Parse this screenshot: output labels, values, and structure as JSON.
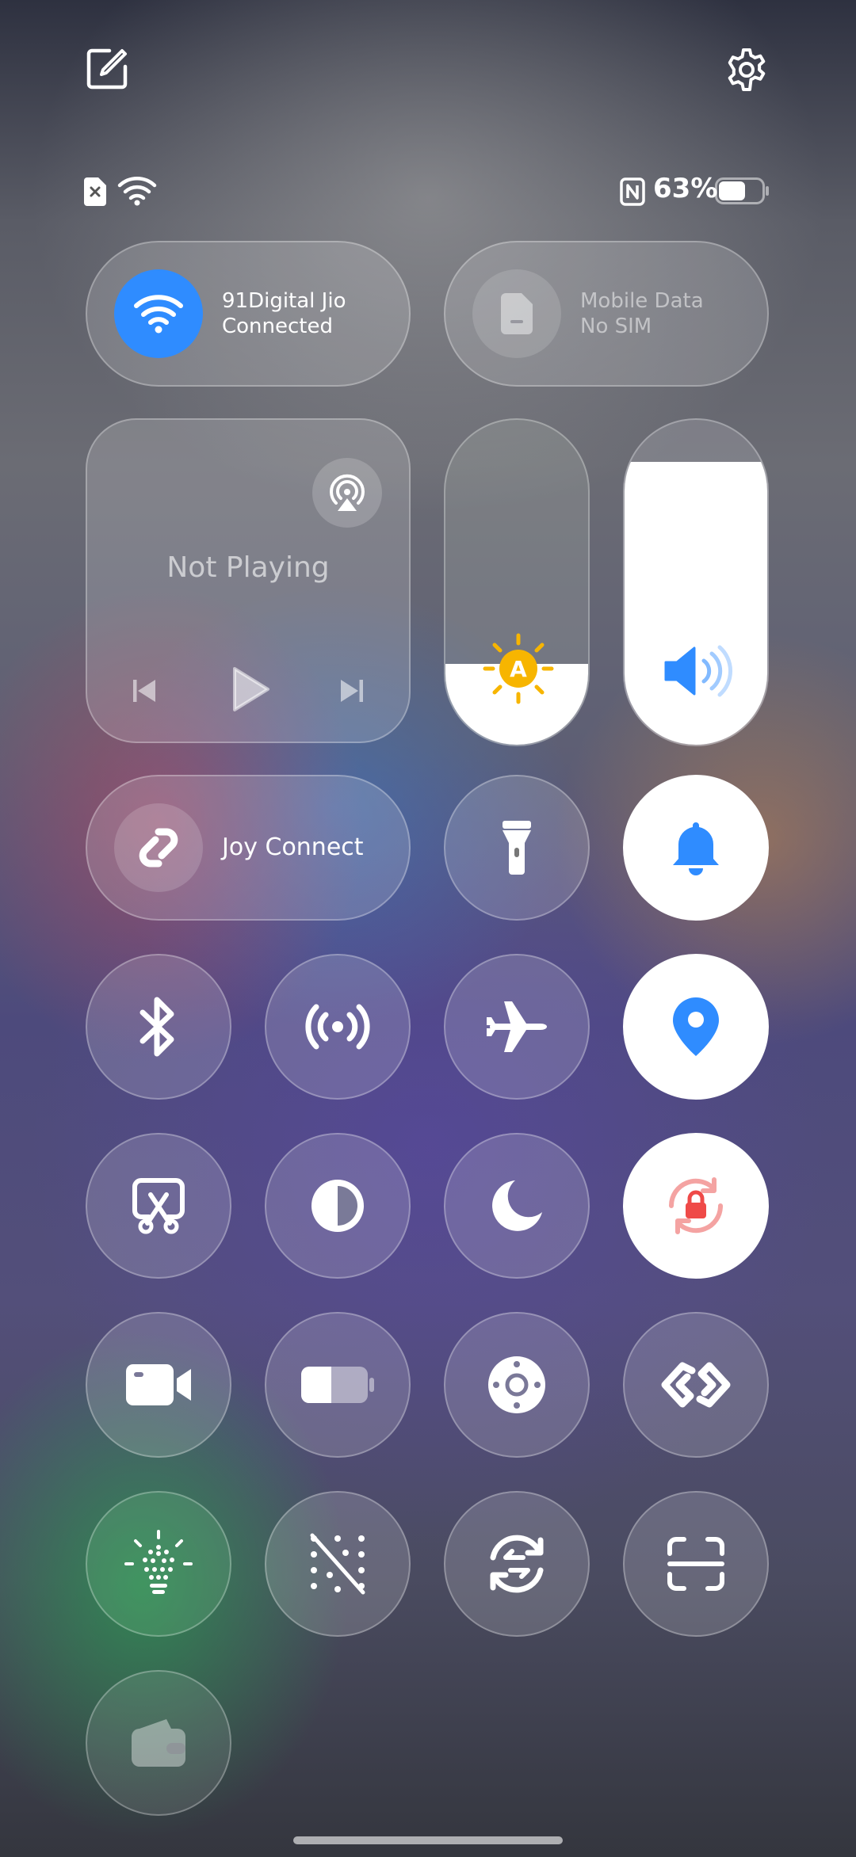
{
  "status_bar": {
    "battery_percent": "63%",
    "battery_level": 0.63
  },
  "wifi_tile": {
    "network_name": "91Digital Jio",
    "status": "Connected"
  },
  "mobile_data_tile": {
    "label": "Mobile Data",
    "status": "No SIM"
  },
  "media": {
    "status": "Not Playing"
  },
  "sliders": {
    "brightness_level": 0.25,
    "brightness_auto_badge": "A",
    "volume_level": 0.87
  },
  "joy_connect": {
    "label": "Joy Connect"
  },
  "colors": {
    "accent_blue": "#2f8cff",
    "sun_yellow": "#f7b500",
    "lock_red": "#ef4a48"
  },
  "tiles": [
    "flashlight-icon",
    "bell-icon",
    "bluetooth-icon",
    "hotspot-icon",
    "airplane-icon",
    "location-icon",
    "screenshot-icon",
    "dark-mode-icon",
    "moon-icon",
    "rotation-lock-icon",
    "screen-record-icon",
    "battery-saver-icon",
    "assistive-touch-icon",
    "link-icon",
    "light-icon",
    "dots-off-icon",
    "sync-icon",
    "scan-icon",
    "wallet-icon"
  ]
}
